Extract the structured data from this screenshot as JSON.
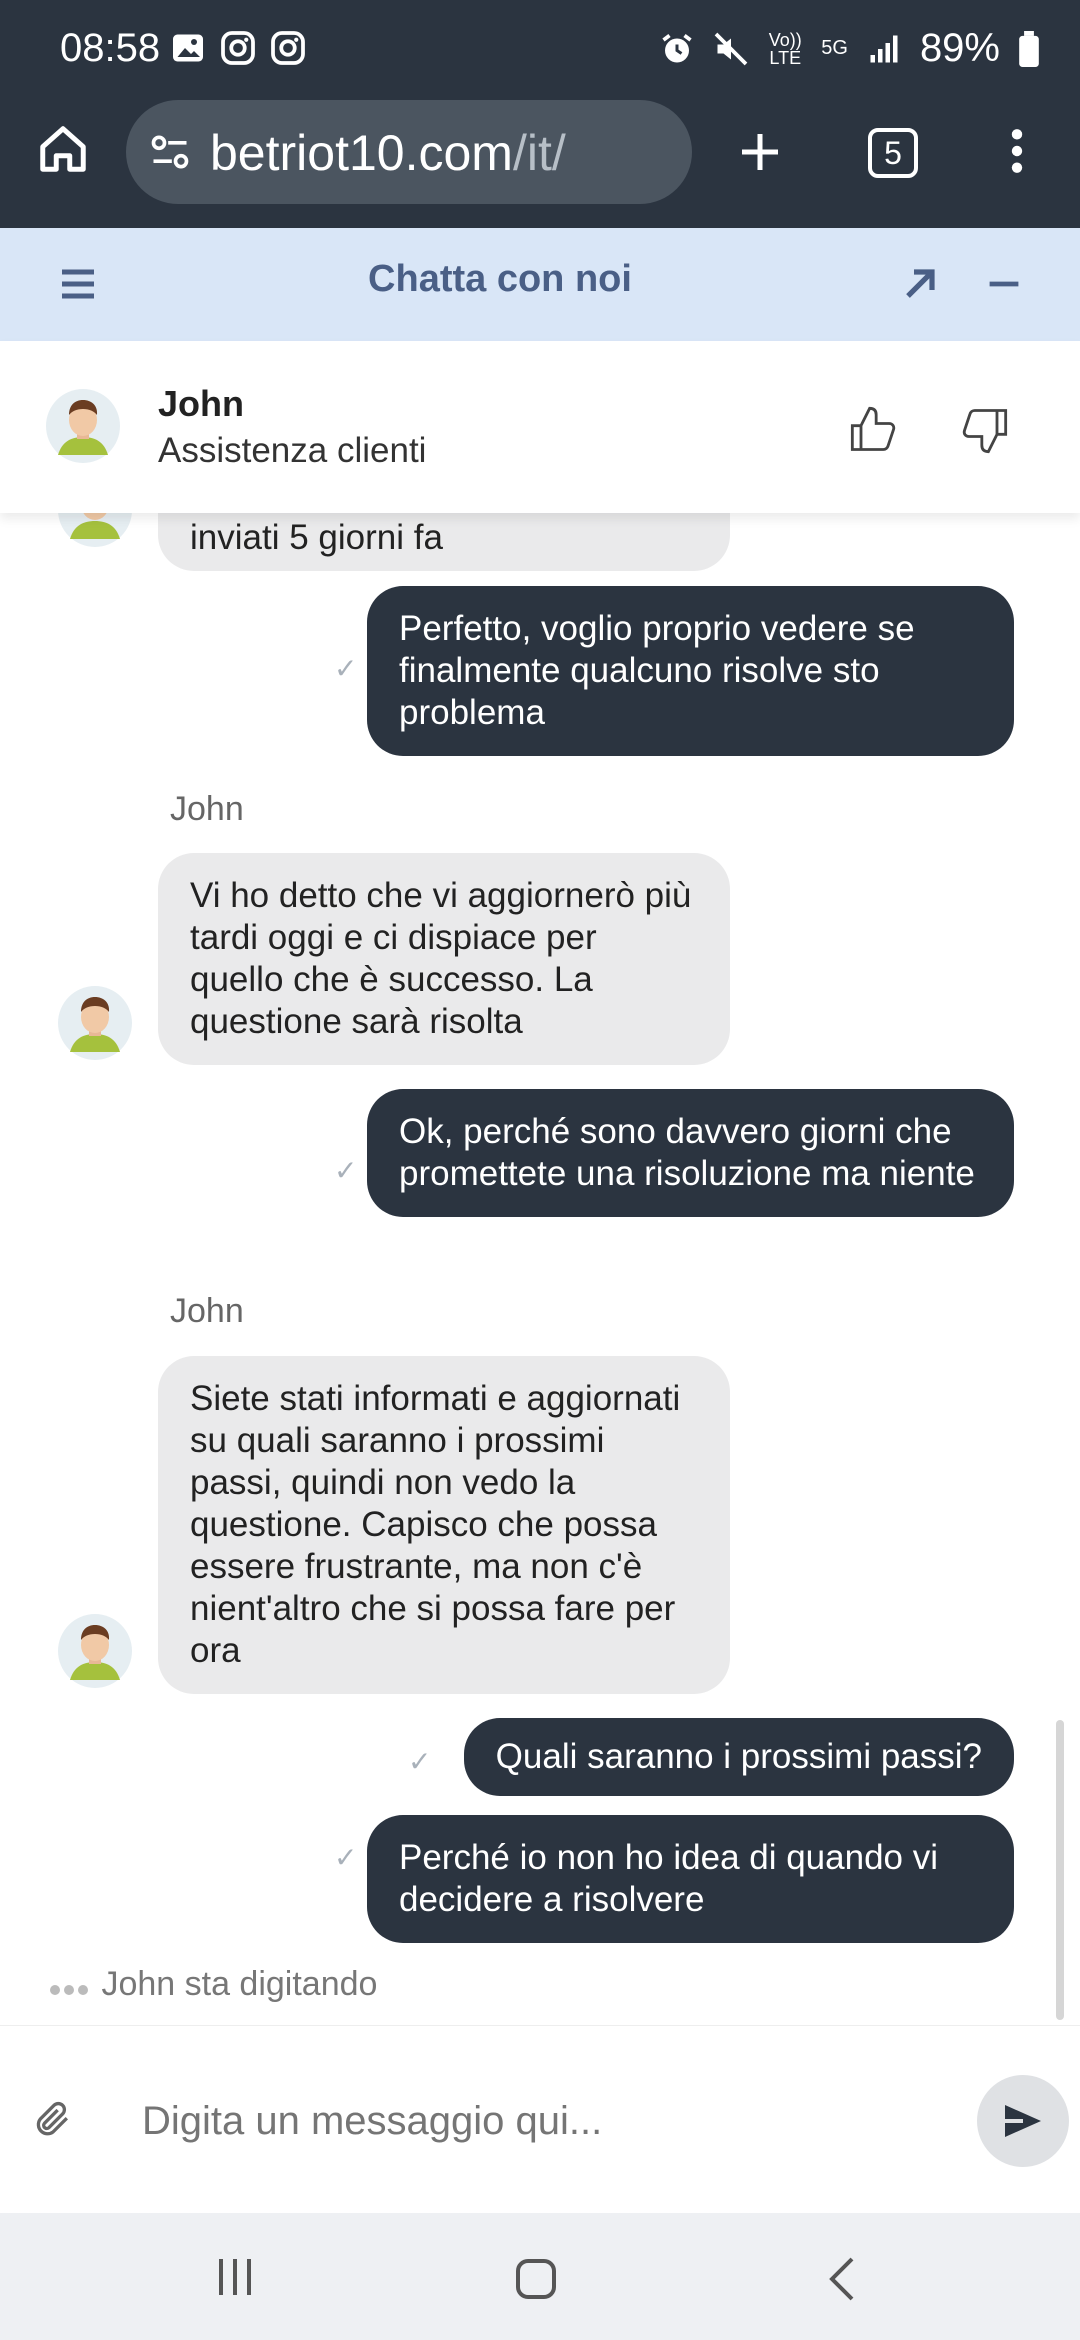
{
  "status_bar": {
    "time": "08:58",
    "battery": "89%",
    "net_lte": "Vo)) LTE",
    "net_5g": "5G"
  },
  "browser": {
    "url_domain": "betriot10.com",
    "url_path": "/it/",
    "tab_count": "5"
  },
  "chat": {
    "title": "Chatta con noi",
    "agent": {
      "name": "John",
      "role": "Assistenza clienti"
    },
    "partial_message": "inviati 5 giorni fa",
    "messages": [
      {
        "from": "user",
        "text": "Perfetto, voglio proprio vedere se finalmente qualcuno risolve sto problema"
      },
      {
        "from": "agent",
        "sender": "John",
        "text": "Vi ho detto che vi aggiornerò più tardi oggi e ci dispiace per quello che è successo. La questione sarà risolta"
      },
      {
        "from": "user",
        "text": "Ok, perché sono davvero giorni che promettete una risoluzione ma niente"
      },
      {
        "from": "agent",
        "sender": "John",
        "text": "Siete stati informati e aggiornati su quali saranno i prossimi passi, quindi non vedo la questione. Capisco che possa essere frustrante, ma non c'è nient'altro che si possa fare per ora"
      },
      {
        "from": "user",
        "text": "Quali saranno i prossimi passi?"
      },
      {
        "from": "user",
        "text": "Perché io non ho idea di quando vi decidere a risolvere"
      }
    ],
    "typing_indicator": "John sta digitando",
    "input_placeholder": "Digita un messaggio qui..."
  }
}
